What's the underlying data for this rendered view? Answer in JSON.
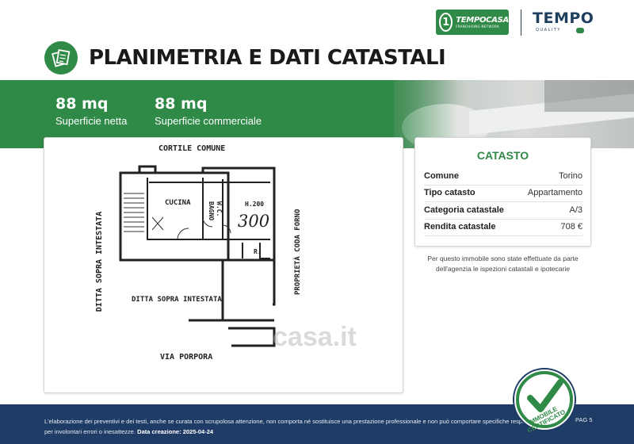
{
  "brand": {
    "tempocasa_name": "TEMPOCASA",
    "tempocasa_tagline": "FRANCHISING NETWORK",
    "tempo_name": "TEMPO",
    "tempo_sub": "QUALITY"
  },
  "page": {
    "title": "PLANIMETRIA E DATI CATASTALI"
  },
  "stats": [
    {
      "value": "88 mq",
      "label": "Superficie netta"
    },
    {
      "value": "88 mq",
      "label": "Superficie commerciale"
    }
  ],
  "plan": {
    "labels": {
      "cortile": "CORTILE COMUNE",
      "cucina": "CUCINA",
      "bagno": "BAGNO",
      "wc": "W.C.",
      "h": "H.200",
      "num": "300",
      "r": "R.",
      "ditta_left": "DITTA SOPRA INTESTATA",
      "ditta_center": "DITTA SOPRA INTESTATA",
      "proprieta": "PROPRIETÀ CODA FORNO",
      "via": "VIA PORPORA",
      "watermark": "casa.it"
    }
  },
  "catasto": {
    "title": "CATASTO",
    "rows": [
      {
        "key": "Comune",
        "value": "Torino"
      },
      {
        "key": "Tipo catasto",
        "value": "Appartamento"
      },
      {
        "key": "Categoria catastale",
        "value": "A/3"
      },
      {
        "key": "Rendita catastale",
        "value": "708 €"
      }
    ],
    "note_line1": "Per questo immobile sono state effettuate da parte",
    "note_line2": "dell'agenzia le ispezioni catastali e ipotecarie"
  },
  "footer": {
    "line1": "L'elaborazione dei preventivi e dei testi, anche se curata con scrupolosa attenzione, non comporta né sostituisce una prestazione professionale e non può comportare specifiche responsabilità",
    "line2_prefix": "per involontari errori o inesattezze.",
    "creation_label": "Data creazione:",
    "creation_date": "2025-04-24",
    "page_label": "PAG 5",
    "seal_line1": "IMMOBILE",
    "seal_line2": "CERTIFICATO"
  },
  "colors": {
    "brand_green": "#2f8a47",
    "footer_navy": "#1f3c66"
  }
}
